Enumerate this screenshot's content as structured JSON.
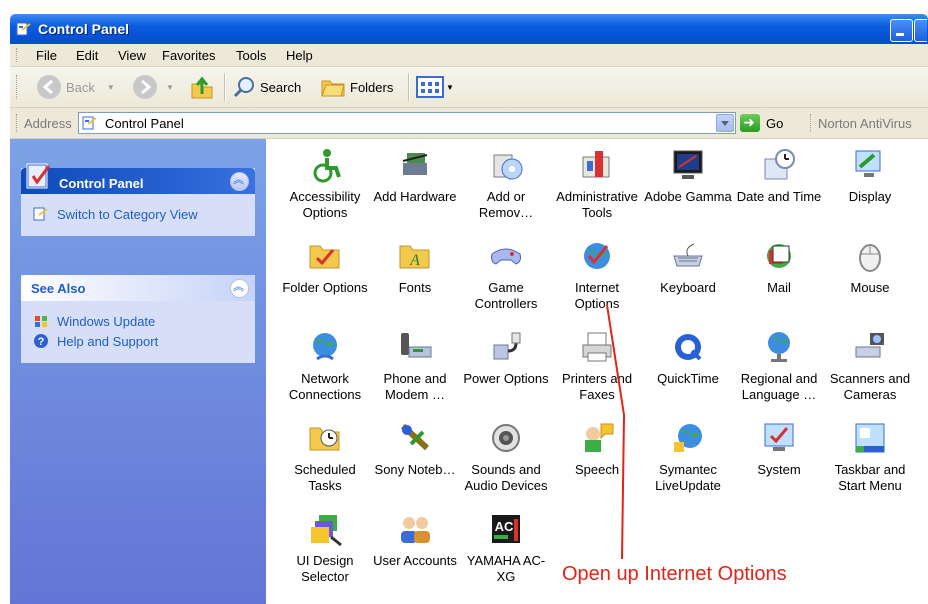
{
  "window": {
    "title": "Control Panel"
  },
  "menu": [
    "File",
    "Edit",
    "View",
    "Favorites",
    "Tools",
    "Help"
  ],
  "toolbar": {
    "back": "Back",
    "search": "Search",
    "folders": "Folders"
  },
  "address": {
    "label": "Address",
    "value": "Control Panel",
    "go": "Go",
    "norton": "Norton AntiVirus"
  },
  "sidebar": {
    "control_panel": {
      "title": "Control Panel",
      "link": "Switch to Category View"
    },
    "see_also": {
      "title": "See Also",
      "links": [
        "Windows Update",
        "Help and Support"
      ]
    }
  },
  "items": [
    {
      "label": "Accessibility Options",
      "icon": "accessibility-icon"
    },
    {
      "label": "Add Hardware",
      "icon": "hardware-icon"
    },
    {
      "label": "Add or Remov…",
      "icon": "add-remove-icon"
    },
    {
      "label": "Administrative Tools",
      "icon": "admin-tools-icon"
    },
    {
      "label": "Adobe Gamma",
      "icon": "monitor-icon"
    },
    {
      "label": "Date and Time",
      "icon": "clock-icon"
    },
    {
      "label": "Display",
      "icon": "display-icon"
    },
    {
      "label": "Folder Options",
      "icon": "folder-check-icon"
    },
    {
      "label": "Fonts",
      "icon": "fonts-folder-icon"
    },
    {
      "label": "Game Controllers",
      "icon": "gamepad-icon"
    },
    {
      "label": "Internet Options",
      "icon": "globe-check-icon"
    },
    {
      "label": "Keyboard",
      "icon": "keyboard-icon"
    },
    {
      "label": "Mail",
      "icon": "mail-icon"
    },
    {
      "label": "Mouse",
      "icon": "mouse-icon"
    },
    {
      "label": "Network Connections",
      "icon": "network-globe-icon"
    },
    {
      "label": "Phone and Modem …",
      "icon": "phone-icon"
    },
    {
      "label": "Power Options",
      "icon": "power-plug-icon"
    },
    {
      "label": "Printers and Faxes",
      "icon": "printer-icon"
    },
    {
      "label": "QuickTime",
      "icon": "quicktime-icon"
    },
    {
      "label": "Regional and Language …",
      "icon": "globe-stand-icon"
    },
    {
      "label": "Scanners and Cameras",
      "icon": "scanner-icon"
    },
    {
      "label": "Scheduled Tasks",
      "icon": "scheduled-folder-icon"
    },
    {
      "label": "Sony Noteb…",
      "icon": "sony-icon"
    },
    {
      "label": "Sounds and Audio Devices",
      "icon": "speaker-icon"
    },
    {
      "label": "Speech",
      "icon": "speech-icon"
    },
    {
      "label": "Symantec LiveUpdate",
      "icon": "liveupdate-icon"
    },
    {
      "label": "System",
      "icon": "system-icon"
    },
    {
      "label": "Taskbar and Start Menu",
      "icon": "taskbar-icon"
    },
    {
      "label": "UI Design Selector",
      "icon": "ui-design-icon"
    },
    {
      "label": "User Accounts",
      "icon": "users-icon"
    },
    {
      "label": "YAMAHA AC-XG",
      "icon": "yamaha-icon"
    }
  ],
  "annotation": "Open up Internet Options",
  "colors": {
    "titlebar": "#0a5ddf",
    "link": "#215dc6",
    "annotation": "#e32418"
  }
}
